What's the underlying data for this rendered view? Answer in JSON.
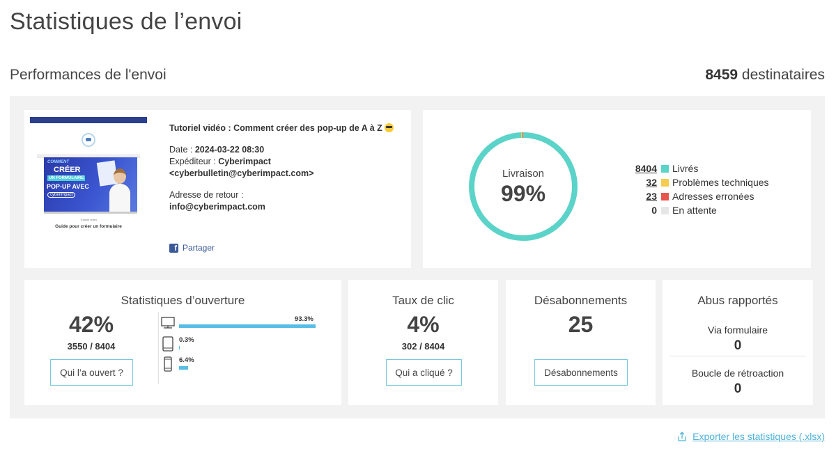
{
  "page": {
    "title": "Statistiques de l’envoi",
    "section_title": "Performances de l'envoi",
    "recipients_count": "8459",
    "recipients_label": "destinataires"
  },
  "email": {
    "subject": "Tutoriel vidéo : Comment créer des pop-up de A à Z",
    "date_label": "Date : ",
    "date_value": "2024-03-22 08:30",
    "sender_label": "Expéditeur : ",
    "sender_name": "Cyberimpact",
    "sender_email": "<cyberbulletin@cyberimpact.com>",
    "return_label": "Adresse de retour :",
    "return_email": "info@cyberimpact.com",
    "share_label": "Partager",
    "thumbnail": {
      "headline_top": "COMMENT",
      "headline_main": "CRÉER",
      "headline_sub": "UN FORMULAIRE",
      "headline_popup": "POP-UP AVEC",
      "brand": "cyberimpact",
      "caption_small": "Tutoriel vidéo",
      "caption": "Guide pour créer un formulaire"
    }
  },
  "delivery": {
    "label": "Livraison",
    "percent": "99%",
    "legend": [
      {
        "count": "8404",
        "label": "Livrés",
        "color": "#5bd3c9",
        "underline": true,
        "value": 8404
      },
      {
        "count": "32",
        "label": "Problèmes techniques",
        "color": "#f5cc4e",
        "underline": true,
        "value": 32
      },
      {
        "count": "23",
        "label": "Adresses erronées",
        "color": "#e8554c",
        "underline": true,
        "value": 23
      },
      {
        "count": "0",
        "label": "En attente",
        "color": "#e6e6e6",
        "underline": false,
        "value": 0
      }
    ]
  },
  "opens": {
    "title": "Statistiques d’ouverture",
    "percent": "42%",
    "ratio": "3550 / 8404",
    "button": "Qui l’a ouvert ?",
    "devices": [
      {
        "icon": "desktop-icon",
        "percent": "93.3%",
        "value": 93.3
      },
      {
        "icon": "tablet-icon",
        "percent": "0.3%",
        "value": 0.3
      },
      {
        "icon": "mobile-icon",
        "percent": "6.4%",
        "value": 6.4
      }
    ]
  },
  "clicks": {
    "title": "Taux de clic",
    "percent": "4%",
    "ratio": "302 / 8404",
    "button": "Qui a cliqué ?"
  },
  "unsubscribes": {
    "title": "Désabonnements",
    "count": "25",
    "button": "Désabonnements"
  },
  "abuse": {
    "title": "Abus rapportés",
    "form_label": "Via formulaire",
    "form_value": "0",
    "feedback_label": "Boucle de rétroaction",
    "feedback_value": "0"
  },
  "export": {
    "label": "Exporter les statistiques (.xlsx)"
  },
  "colors": {
    "accent": "#4fb3d9",
    "bar": "#56bde6",
    "button_border": "#74c9dd",
    "panel_bg": "#f2f2f2"
  }
}
